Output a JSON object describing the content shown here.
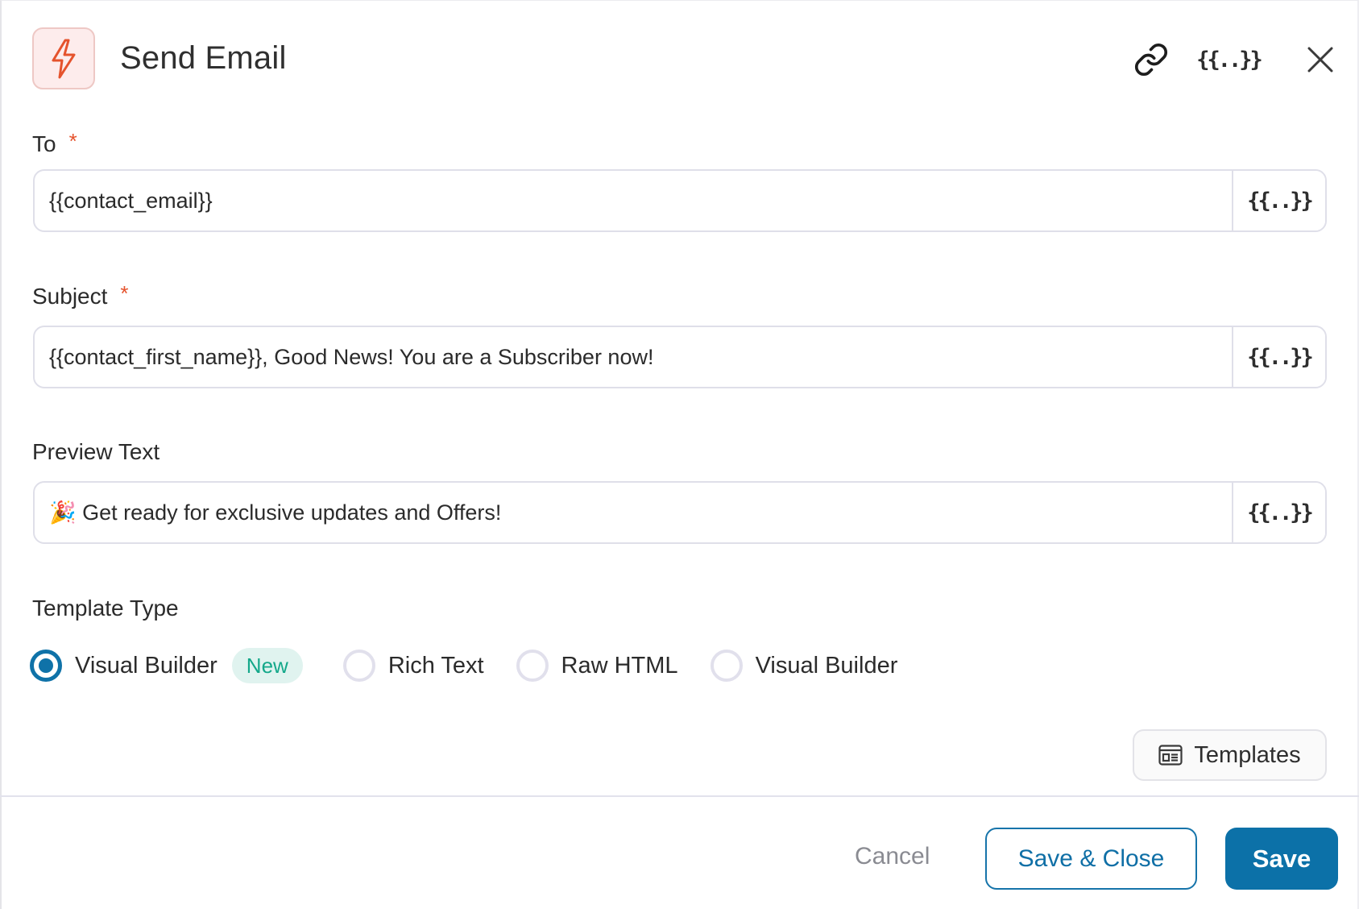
{
  "header": {
    "title": "Send Email",
    "icon": "lightning-bolt-icon",
    "actions": [
      {
        "name": "link-icon"
      },
      {
        "name": "variables-icon",
        "glyph": "{{..}}"
      },
      {
        "name": "close-icon"
      }
    ]
  },
  "fields": {
    "to": {
      "label": "To",
      "required_mark": "*",
      "value": "{{contact_email}}",
      "var_button": "{{..}}"
    },
    "subject": {
      "label": "Subject",
      "required_mark": "*",
      "value": "{{contact_first_name}}, Good News! You are a Subscriber now!",
      "var_button": "{{..}}"
    },
    "preview_text": {
      "label": "Preview Text",
      "value": "🎉 Get ready for exclusive updates and Offers!",
      "var_button": "{{..}}"
    }
  },
  "template_type": {
    "label": "Template Type",
    "options": [
      {
        "label": "Visual Builder",
        "badge": "New",
        "checked": true
      },
      {
        "label": "Rich Text",
        "checked": false
      },
      {
        "label": "Raw HTML",
        "checked": false
      },
      {
        "label": "Visual Builder",
        "checked": false
      }
    ],
    "templates_button": "Templates"
  },
  "footer": {
    "cancel": "Cancel",
    "save_close": "Save & Close",
    "save": "Save"
  },
  "colors": {
    "primary": "#0c71a8",
    "required": "#e5532d",
    "badge_text": "#14a88a",
    "badge_bg": "#e0f3ef",
    "icon_accent": "#e5532d"
  }
}
